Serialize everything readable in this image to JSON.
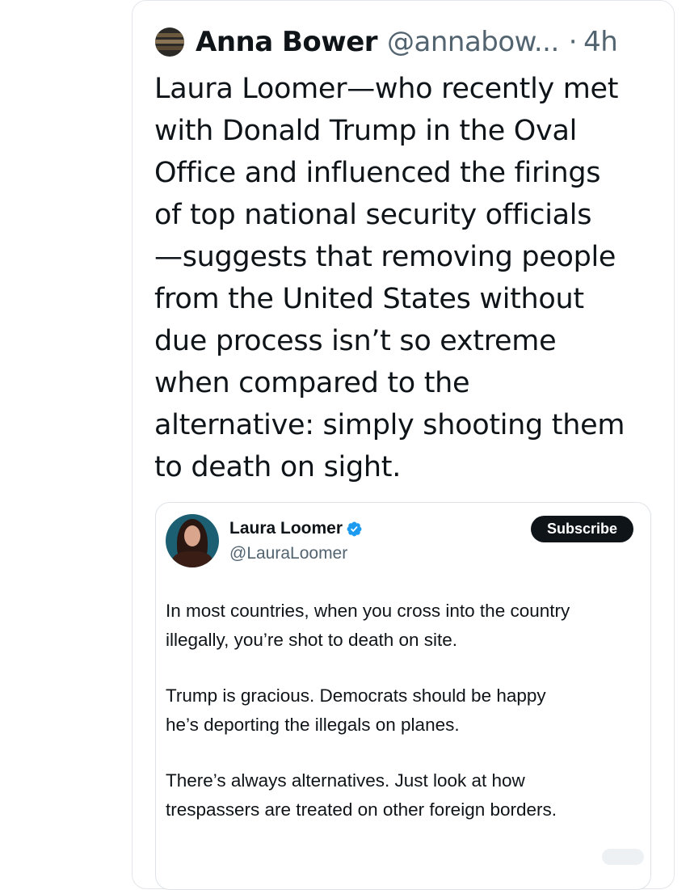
{
  "post": {
    "author_name": "Anna Bower",
    "author_handle": "@annabow...",
    "separator": "·",
    "time": "4h",
    "text_lines": [
      "Laura Loomer—who recently met",
      "with Donald Trump in the Oval",
      "Office and influenced the firings",
      "of top national security officials",
      "—suggests that removing people",
      "from the United States without",
      "due process isn’t so extreme",
      "when compared to the",
      "alternative: simply shooting them",
      "to death on sight."
    ]
  },
  "quoted_post": {
    "author_name": "Laura Loomer",
    "author_handle": "@LauraLoomer",
    "verified": true,
    "subscribe_label": "Subscribe",
    "paragraphs": [
      [
        "In most countries, when you cross into the country",
        "illegally, you’re shot to death on site."
      ],
      [
        "Trump is gracious. Democrats should be happy",
        "he’s deporting the illegals on planes."
      ],
      [
        "There’s always alternatives. Just look at how",
        "trespassers are treated on other foreign borders."
      ]
    ]
  },
  "colors": {
    "text_primary": "#0f1419",
    "text_secondary": "#536471",
    "verified_blue": "#1d9bf0",
    "border": "#e3e6ea",
    "subscribe_bg": "#0f1419"
  },
  "icons": {
    "author_avatar": "avatar-bookshelf-icon",
    "quoted_avatar": "avatar-portrait-icon",
    "verified": "verified-badge-icon"
  }
}
